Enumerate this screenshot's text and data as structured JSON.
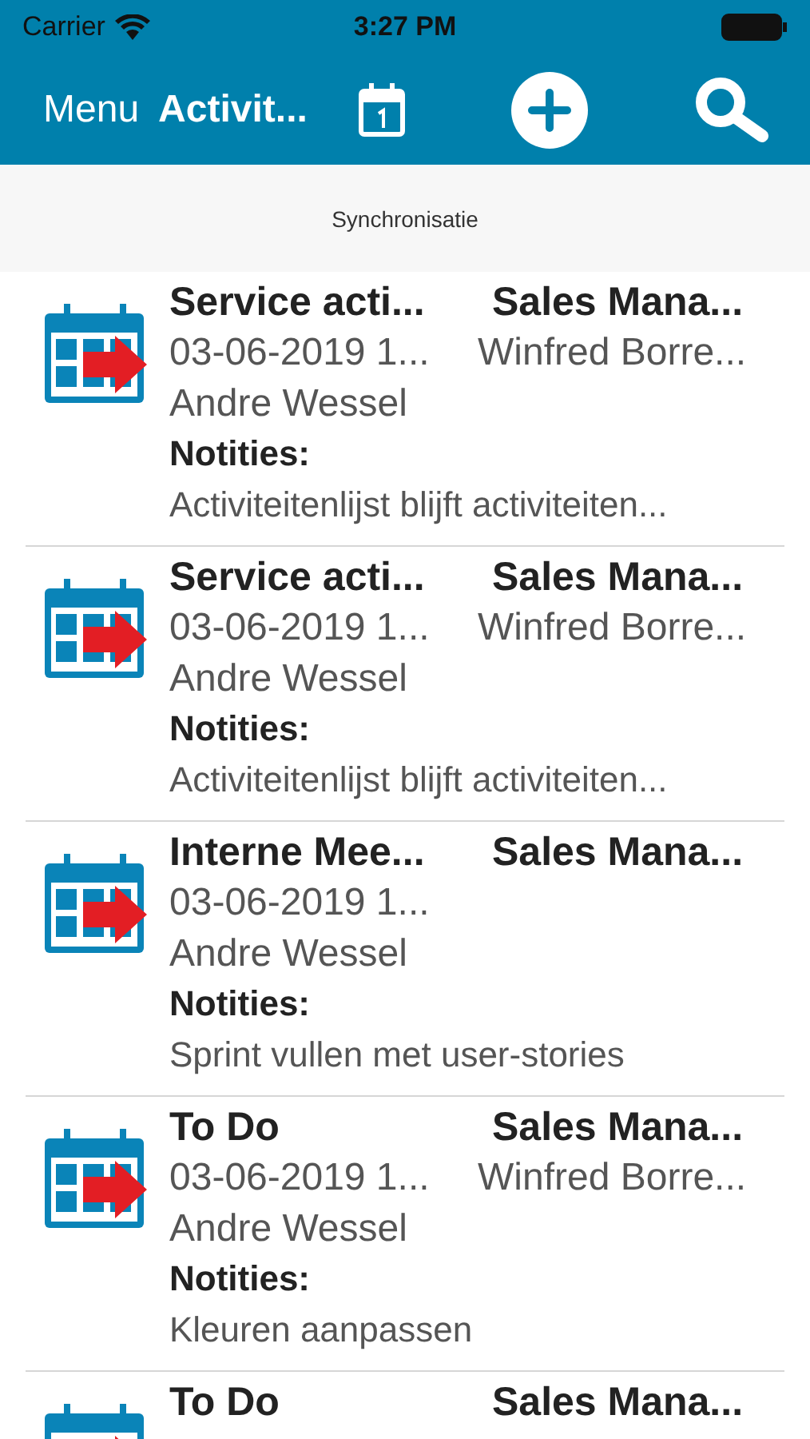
{
  "status_bar": {
    "carrier": "Carrier",
    "time": "3:27 PM"
  },
  "nav_bar": {
    "menu": "Menu",
    "title": "Activit..."
  },
  "sync_bar": {
    "label": "Synchronisatie"
  },
  "activities": [
    {
      "title": "Service acti...",
      "role": "Sales Mana...",
      "date": "03-06-2019 1...",
      "owner": "Winfred Borre...",
      "contact": "Andre Wessel",
      "notes_label": "Notities:",
      "notes": "Activiteitenlijst blijft activiteiten..."
    },
    {
      "title": "Service acti...",
      "role": "Sales Mana...",
      "date": "03-06-2019 1...",
      "owner": "Winfred Borre...",
      "contact": "Andre Wessel",
      "notes_label": "Notities:",
      "notes": "Activiteitenlijst blijft activiteiten..."
    },
    {
      "title": "Interne Mee...",
      "role": "Sales Mana...",
      "date": "03-06-2019 1...",
      "contact": "Andre Wessel",
      "notes_label": "Notities:",
      "notes": "Sprint vullen met user-stories"
    },
    {
      "title": "To Do",
      "role": "Sales Mana...",
      "date": "03-06-2019 1...",
      "owner": "Winfred Borre...",
      "contact": "Andre Wessel",
      "notes_label": "Notities:",
      "notes": "Kleuren aanpassen"
    },
    {
      "title": "To Do",
      "role": "Sales Mana..."
    }
  ]
}
